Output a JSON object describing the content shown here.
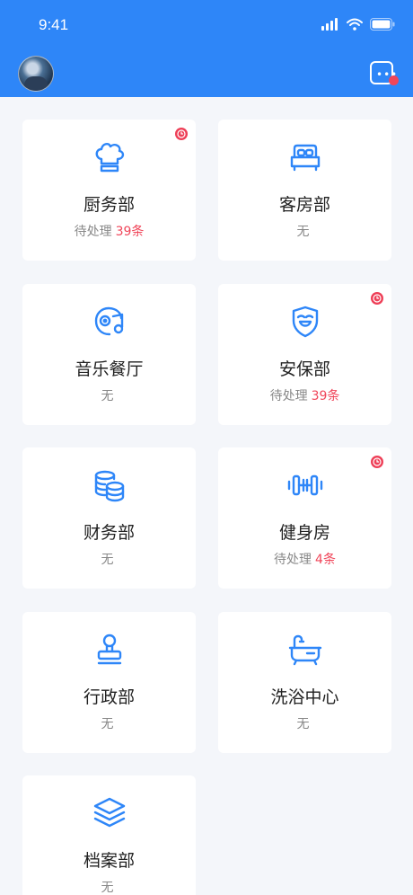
{
  "status_bar": {
    "time": "9:41"
  },
  "header": {
    "avatar": "user-avatar",
    "message_icon": "message-icon"
  },
  "departments": [
    {
      "name": "厨务部",
      "icon": "chef-hat-icon",
      "status": "待处理",
      "count": "39条",
      "badge": true
    },
    {
      "name": "客房部",
      "icon": "bed-icon",
      "status": "无",
      "count": "",
      "badge": false
    },
    {
      "name": "音乐餐厅",
      "icon": "music-icon",
      "status": "无",
      "count": "",
      "badge": false
    },
    {
      "name": "安保部",
      "icon": "shield-icon",
      "status": "待处理",
      "count": "39条",
      "badge": true
    },
    {
      "name": "财务部",
      "icon": "coins-icon",
      "status": "无",
      "count": "",
      "badge": false
    },
    {
      "name": "健身房",
      "icon": "dumbbell-icon",
      "status": "待处理",
      "count": "4条",
      "badge": true
    },
    {
      "name": "行政部",
      "icon": "stamp-icon",
      "status": "无",
      "count": "",
      "badge": false
    },
    {
      "name": "洗浴中心",
      "icon": "bathtub-icon",
      "status": "无",
      "count": "",
      "badge": false
    },
    {
      "name": "档案部",
      "icon": "layers-icon",
      "status": "无",
      "count": "",
      "badge": false
    }
  ],
  "colors": {
    "primary": "#2E86F8",
    "alert": "#F0465A",
    "background": "#F4F6FA"
  }
}
